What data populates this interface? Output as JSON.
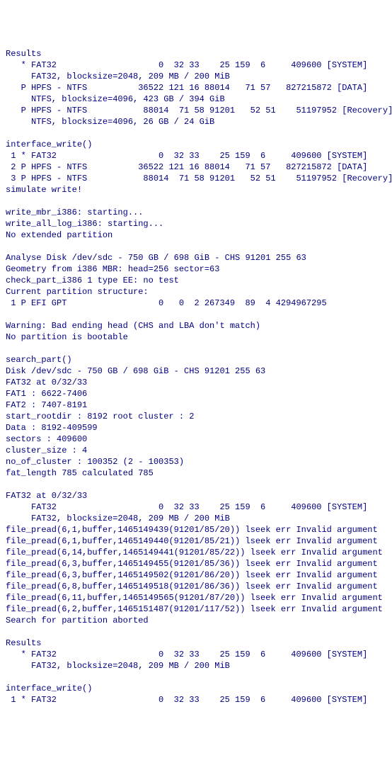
{
  "lines": [
    "Results",
    "   * FAT32                    0  32 33    25 159  6     409600 [SYSTEM]",
    "     FAT32, blocksize=2048, 209 MB / 200 MiB",
    "   P HPFS - NTFS          36522 121 16 88014   71 57   827215872 [DATA]",
    "     NTFS, blocksize=4096, 423 GB / 394 GiB",
    "   P HPFS - NTFS           88014  71 58 91201   52 51    51197952 [Recovery]",
    "     NTFS, blocksize=4096, 26 GB / 24 GiB",
    "",
    "interface_write()",
    " 1 * FAT32                    0  32 33    25 159  6     409600 [SYSTEM]",
    " 2 P HPFS - NTFS          36522 121 16 88014   71 57   827215872 [DATA]",
    " 3 P HPFS - NTFS           88014  71 58 91201   52 51    51197952 [Recovery]",
    "simulate write!",
    "",
    "write_mbr_i386: starting...",
    "write_all_log_i386: starting...",
    "No extended partition",
    "",
    "Analyse Disk /dev/sdc - 750 GB / 698 GiB - CHS 91201 255 63",
    "Geometry from i386 MBR: head=256 sector=63",
    "check_part_i386 1 type EE: no test",
    "Current partition structure:",
    " 1 P EFI GPT                  0   0  2 267349  89  4 4294967295",
    "",
    "Warning: Bad ending head (CHS and LBA don't match)",
    "No partition is bootable",
    "",
    "search_part()",
    "Disk /dev/sdc - 750 GB / 698 GiB - CHS 91201 255 63",
    "FAT32 at 0/32/33",
    "FAT1 : 6622-7406",
    "FAT2 : 7407-8191",
    "start_rootdir : 8192 root cluster : 2",
    "Data : 8192-409599",
    "sectors : 409600",
    "cluster_size : 4",
    "no_of_cluster : 100352 (2 - 100353)",
    "fat_length 785 calculated 785",
    "",
    "FAT32 at 0/32/33",
    "     FAT32                    0  32 33    25 159  6     409600 [SYSTEM]",
    "     FAT32, blocksize=2048, 209 MB / 200 MiB",
    "file_pread(6,1,buffer,1465149439(91201/85/20)) lseek err Invalid argument",
    "file_pread(6,1,buffer,1465149440(91201/85/21)) lseek err Invalid argument",
    "file_pread(6,14,buffer,1465149441(91201/85/22)) lseek err Invalid argument",
    "file_pread(6,3,buffer,1465149455(91201/85/36)) lseek err Invalid argument",
    "file_pread(6,3,buffer,1465149502(91201/86/20)) lseek err Invalid argument",
    "file_pread(6,8,buffer,1465149518(91201/86/36)) lseek err Invalid argument",
    "file_pread(6,11,buffer,1465149565(91201/87/20)) lseek err Invalid argument",
    "file_pread(6,2,buffer,1465151487(91201/117/52)) lseek err Invalid argument",
    "Search for partition aborted",
    "",
    "Results",
    "   * FAT32                    0  32 33    25 159  6     409600 [SYSTEM]",
    "     FAT32, blocksize=2048, 209 MB / 200 MiB",
    "",
    "interface_write()",
    " 1 * FAT32                    0  32 33    25 159  6     409600 [SYSTEM]"
  ]
}
